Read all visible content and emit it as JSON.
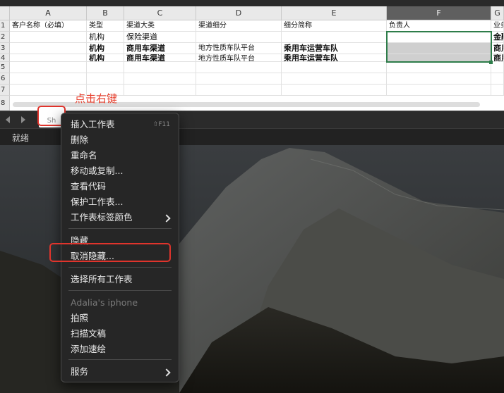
{
  "spreadsheet": {
    "columns": [
      {
        "letter": "A"
      },
      {
        "letter": "B"
      },
      {
        "letter": "C"
      },
      {
        "letter": "D"
      },
      {
        "letter": "E"
      },
      {
        "letter": "F"
      },
      {
        "letter": "G"
      }
    ],
    "rows": [
      "1",
      "2",
      "3",
      "4",
      "5",
      "6",
      "7",
      "8"
    ],
    "header_row": [
      "客户名称（必填）",
      "类型",
      "渠道大类",
      "渠道细分",
      "细分简称",
      "负责人",
      "业务"
    ],
    "row2": [
      "",
      "机构",
      "保险渠道",
      "",
      "",
      "",
      "金融"
    ],
    "row3": [
      "",
      "机构",
      "商用车渠道",
      "地方性质车队平台",
      "乘用车运营车队",
      "",
      "商用"
    ],
    "row4": [
      "",
      "机构",
      "商用车渠道",
      "地方性质车队平台",
      "乘用车运营车队",
      "",
      "商用"
    ]
  },
  "annotation_text": "点击右键",
  "sheet_tab": {
    "label": "Sh"
  },
  "status": {
    "label": "就绪"
  },
  "context_menu": {
    "items": [
      {
        "label": "插入工作表",
        "shortcut": "⇧F11"
      },
      {
        "label": "删除"
      },
      {
        "label": "重命名"
      },
      {
        "label": "移动或复制..."
      },
      {
        "label": "查看代码"
      },
      {
        "label": "保护工作表..."
      },
      {
        "label": "工作表标签颜色"
      },
      {
        "label": "隐藏"
      },
      {
        "label": "取消隐藏..."
      },
      {
        "label": "选择所有工作表"
      },
      {
        "label": "Adalia's iphone"
      },
      {
        "label": "拍照"
      },
      {
        "label": "扫描文稿"
      },
      {
        "label": "添加速绘"
      },
      {
        "label": "服务"
      }
    ]
  },
  "colors": {
    "selection": "#2e7d4a",
    "highlight_box": "#e0342c",
    "annotation": "#e8412f",
    "menu_bg": "#262626"
  }
}
